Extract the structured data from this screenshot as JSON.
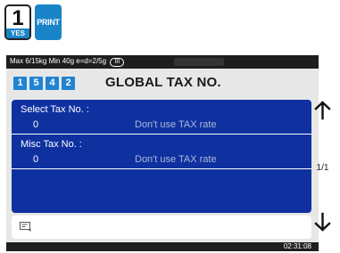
{
  "keys": {
    "one_number": "1",
    "one_caption": "YES",
    "print_label": "PRINT"
  },
  "status": {
    "scale_info": "Max 6/15kg Min 40g e=d=2/5g",
    "range_badge": "III"
  },
  "menu": {
    "path": [
      "1",
      "5",
      "4",
      "2"
    ],
    "title": "GLOBAL TAX NO."
  },
  "fields": [
    {
      "label": "Select Tax No. :",
      "value": "0",
      "description": "Don't use TAX rate"
    },
    {
      "label": "Misc Tax No. :",
      "value": "0",
      "description": "Don't use TAX rate"
    }
  ],
  "pagination": {
    "indicator": "1/1"
  },
  "input": {
    "value": ""
  },
  "clock": {
    "time": "02:31:08"
  },
  "icons": {
    "up": "up-arrow-icon",
    "down": "down-arrow-icon",
    "input": "input-edit-icon"
  },
  "colors": {
    "accent": "#1a84c9",
    "panel": "#0f31a0",
    "menu_step": "#2184d2"
  }
}
